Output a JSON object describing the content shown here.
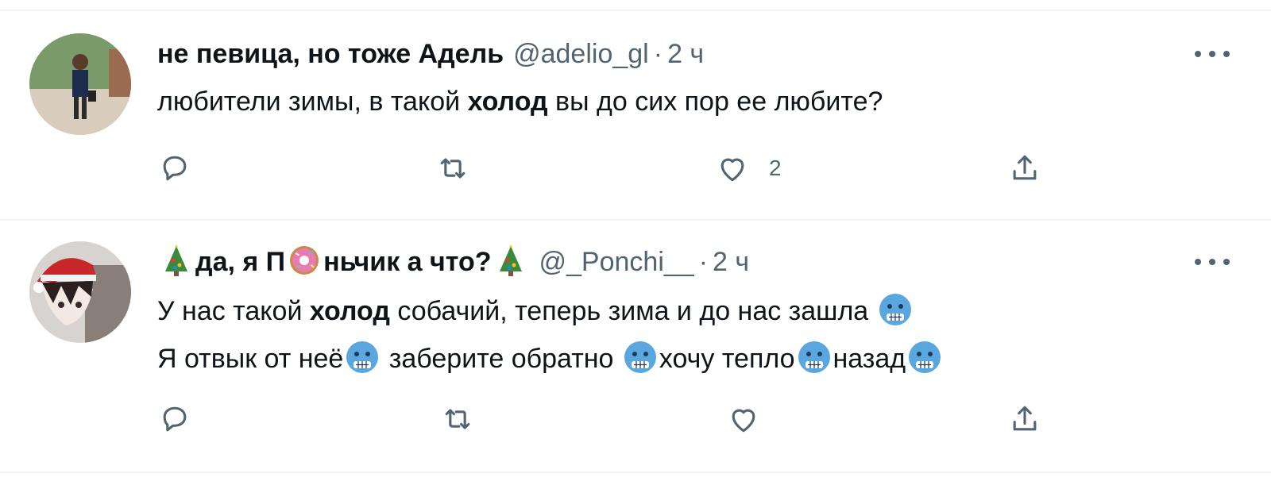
{
  "tweets": [
    {
      "display_name": "не певица, но тоже Адель",
      "handle": "@adelio_gl",
      "dot": "·",
      "time": "2 ч",
      "text_before": "любители зимы, в такой ",
      "text_bold": "холод",
      "text_after": " вы до сих пор ее любите?",
      "likes": "2"
    },
    {
      "display_name_part1": "да, я П",
      "display_name_part2": "ньчик а что?",
      "handle": "@_Ponchi__",
      "dot": "·",
      "time": "2 ч",
      "line1_before": "У нас такой ",
      "line1_bold": "холод",
      "line1_after": " собачий, теперь зима и до нас зашла ",
      "line2_a": "Я отвык от неё",
      "line2_b": " заберите обратно ",
      "line2_c": "хочу тепло",
      "line2_d": "назад"
    }
  ],
  "icons": {
    "reply": "reply-icon",
    "retweet": "retweet-icon",
    "like": "heart-icon",
    "share": "share-icon",
    "more": "more-icon",
    "tree": "christmas-tree-emoji",
    "donut": "donut-emoji",
    "cold": "cold-face-emoji"
  },
  "colors": {
    "text": "#0f1419",
    "secondary": "#536471",
    "separator": "#eff3f4"
  }
}
